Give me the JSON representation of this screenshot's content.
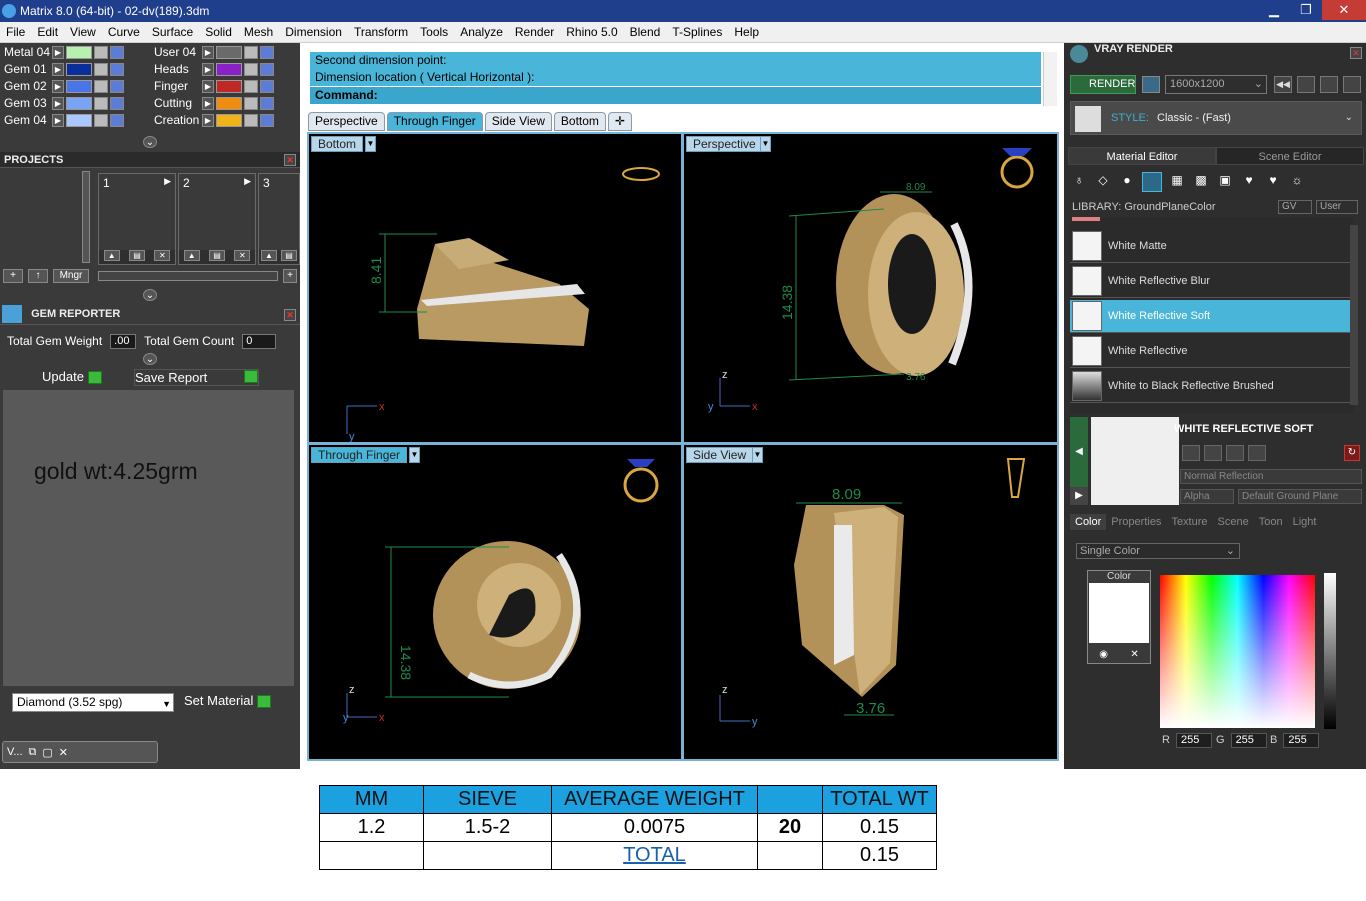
{
  "window": {
    "title": "Matrix 8.0 (64-bit) - 02-dv(189).3dm"
  },
  "menu": [
    "File",
    "Edit",
    "View",
    "Curve",
    "Surface",
    "Solid",
    "Mesh",
    "Dimension",
    "Transform",
    "Tools",
    "Analyze",
    "Render",
    "Rhino 5.0",
    "Blend",
    "T-Splines",
    "Help"
  ],
  "layers_left": [
    {
      "label": "Metal 04",
      "color": "#b8f0b0"
    },
    {
      "label": "Gem 01",
      "color": "#0a2f9b"
    },
    {
      "label": "Gem 02",
      "color": "#4a74e8"
    },
    {
      "label": "Gem 03",
      "color": "#7aa2f6"
    },
    {
      "label": "Gem 04",
      "color": "#a8c8ff"
    }
  ],
  "layers_right": [
    {
      "label": "User 04",
      "color": "#6a6a6a"
    },
    {
      "label": "Heads",
      "color": "#8a20c8"
    },
    {
      "label": "Finger",
      "color": "#c02828"
    },
    {
      "label": "Cutting",
      "color": "#f08c10"
    },
    {
      "label": "Creation",
      "color": "#f0b418"
    }
  ],
  "projects": {
    "title": "PROJECTS",
    "items": [
      "1",
      "2",
      "3"
    ],
    "mngr": "Mngr"
  },
  "gem_reporter": {
    "title": "GEM REPORTER",
    "weight_label": "Total Gem Weight",
    "weight_value": ".00",
    "count_label": "Total Gem Count",
    "count_value": "0",
    "update": "Update",
    "save_report": "Save Report",
    "note": "gold wt:4.25grm",
    "gem": "Diamond    (3.52 spg)",
    "set_material": "Set Material",
    "task": "V..."
  },
  "command": {
    "line1": "Second dimension point:",
    "line2": "Dimension location ( Vertical  Horizontal ):",
    "prompt": "Command:"
  },
  "view_tabs": [
    "Perspective",
    "Through Finger",
    "Side View",
    "Bottom",
    "✛"
  ],
  "viewports": {
    "tl": "Bottom",
    "tr": "Perspective",
    "bl": "Through Finger",
    "br": "Side View"
  },
  "dims": {
    "bottom_h": "8.41",
    "persp_top": "8.09",
    "persp_h": "14.38",
    "persp_bot": "3.76",
    "finger_h": "14.38",
    "side_top": "8.09",
    "side_bot": "3.76"
  },
  "axes": {
    "x": "x",
    "y": "y",
    "z": "z"
  },
  "render": {
    "title": "VRAY RENDER",
    "render_btn": "RENDER",
    "resolution": "1600x1200",
    "style_label": "STYLE:",
    "style_value": "Classic - (Fast)",
    "tab_material": "Material Editor",
    "tab_scene": "Scene Editor",
    "library": "LIBRARY: GroundPlaneColor",
    "gv": "GV",
    "user": "User"
  },
  "materials": [
    "White Matte",
    "White Reflective Blur",
    "White Reflective Soft",
    "White Reflective",
    "White to Black Reflective Brushed"
  ],
  "selected_material": "WHITE REFLECTIVE SOFT",
  "mat_props": {
    "reflection": "Normal Reflection",
    "alpha": "Alpha",
    "ground": "Default Ground Plane"
  },
  "color_tabs": [
    "Color",
    "Properties",
    "Texture",
    "Scene",
    "Toon",
    "Light"
  ],
  "color": {
    "mode": "Single Color",
    "label": "Color",
    "r": "255",
    "g": "255",
    "b": "255",
    "r_label": "R",
    "g_label": "G",
    "b_label": "B"
  },
  "table": {
    "headers": [
      "MM",
      "SIEVE",
      "AVERAGE WEIGHT",
      "",
      "TOTAL WT"
    ],
    "row": [
      "1.2",
      "1.5-2",
      "0.0075",
      "20",
      "0.15"
    ],
    "total_label": "TOTAL",
    "total_value": "0.15"
  }
}
